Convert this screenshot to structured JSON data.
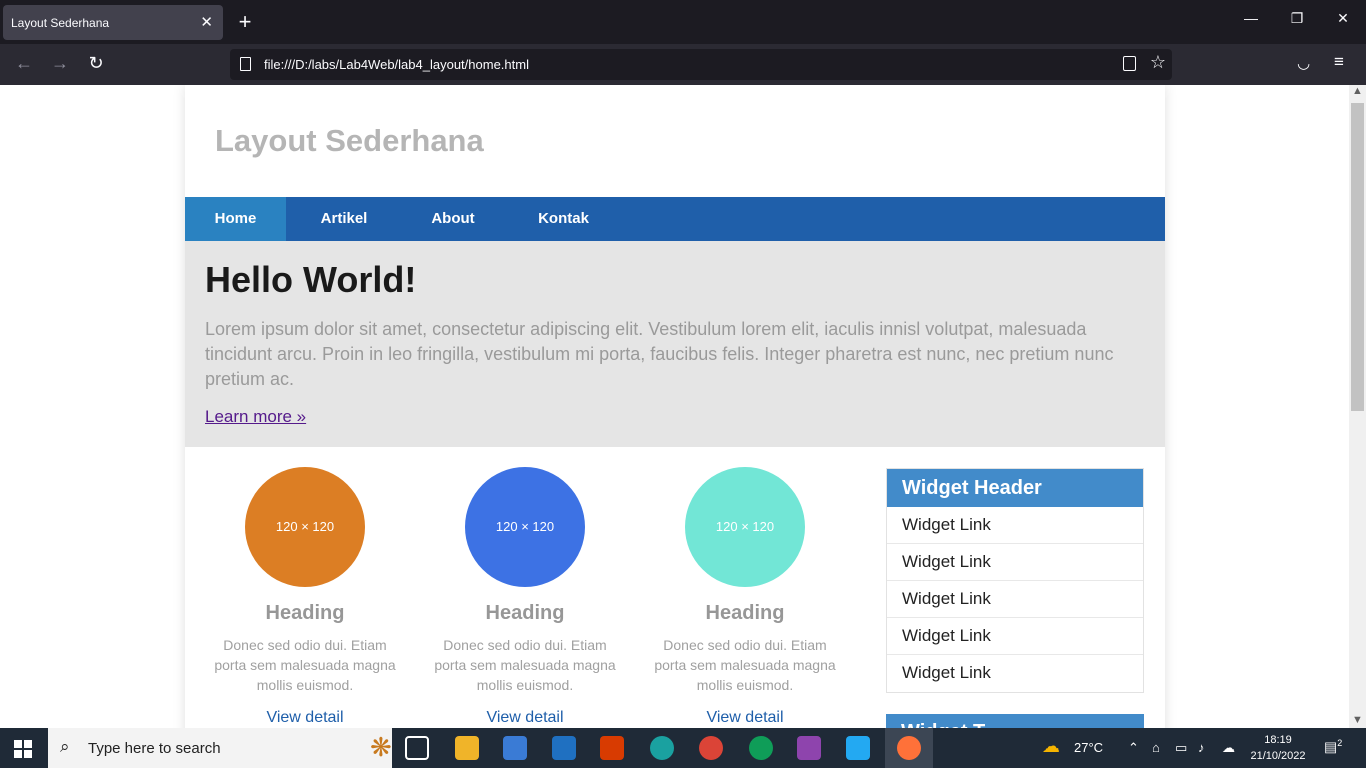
{
  "browser": {
    "tab_title": "Layout Sederhana",
    "tab_close": "✕",
    "new_tab": "+",
    "url": "file:///D:/labs/Lab4Web/lab4_layout/home.html",
    "window_controls": {
      "minimize": "—",
      "restore": "❐",
      "close": "✕"
    },
    "nav": {
      "back": "←",
      "forward": "→",
      "reload": "↻"
    },
    "star_icon": "☆",
    "pocket_icon": "◡",
    "menu_icon": "≡"
  },
  "page": {
    "site_title": "Layout Sederhana",
    "menu": [
      {
        "label": "Home",
        "active": true
      },
      {
        "label": "Artikel",
        "active": false
      },
      {
        "label": "About",
        "active": false
      },
      {
        "label": "Kontak",
        "active": false
      }
    ],
    "hero": {
      "title": "Hello World!",
      "text": "Lorem ipsum dolor sit amet, consectetur adipiscing elit. Vestibulum lorem elit, iaculis innisl volutpat, malesuada tincidunt arcu. Proin in leo fringilla, vestibulum mi porta, faucibus felis. Integer pharetra est nunc, nec pretium nunc pretium ac.",
      "link": "Learn more »"
    },
    "features": [
      {
        "image_label": "120 × 120",
        "color": "#dc7e24",
        "heading": "Heading",
        "text": "Donec sed odio dui. Etiam porta sem malesuada magna mollis euismod.",
        "link": "View detail"
      },
      {
        "image_label": "120 × 120",
        "color": "#3d72e4",
        "heading": "Heading",
        "text": "Donec sed odio dui. Etiam porta sem malesuada magna mollis euismod.",
        "link": "View detail"
      },
      {
        "image_label": "120 × 120",
        "color": "#72e6d6",
        "heading": "Heading",
        "text": "Donec sed odio dui. Etiam porta sem malesuada magna mollis euismod.",
        "link": "View detail"
      }
    ],
    "widget": {
      "header": "Widget Header",
      "links": [
        "Widget Link",
        "Widget Link",
        "Widget Link",
        "Widget Link",
        "Widget Link"
      ]
    },
    "widget2_header": "Widget T"
  },
  "taskbar": {
    "search_placeholder": "Type here to search",
    "search_icon": "⌕",
    "temperature": "27°C",
    "time": "18:19",
    "date": "21/10/2022",
    "notification_count": "2",
    "chevron": "⌃",
    "weather_icon": "☁"
  },
  "colors": {
    "menu_bar": "#1f5faa",
    "menu_active": "#2a82c1",
    "widget_header": "#428bca",
    "hero_bg": "#e5e5e5"
  }
}
